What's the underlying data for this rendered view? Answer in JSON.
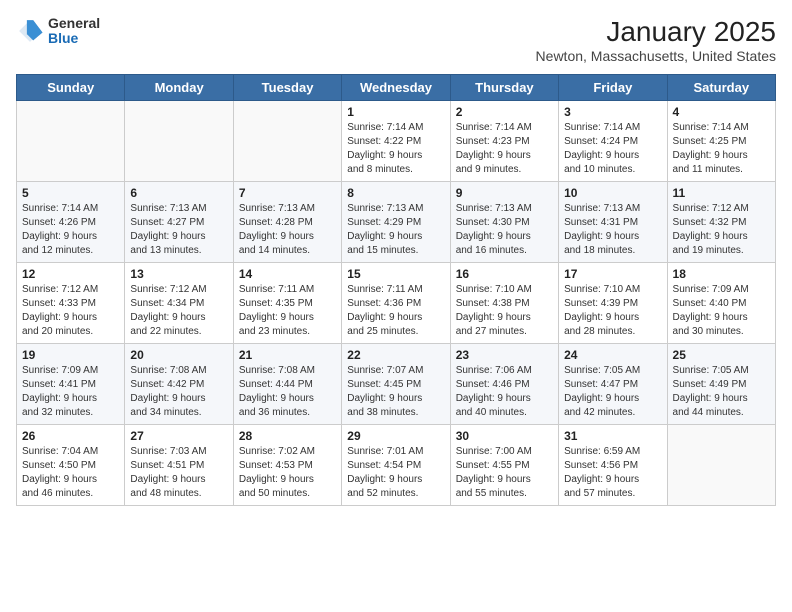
{
  "header": {
    "logo": {
      "general": "General",
      "blue": "Blue"
    },
    "title": "January 2025",
    "location": "Newton, Massachusetts, United States"
  },
  "weekdays": [
    "Sunday",
    "Monday",
    "Tuesday",
    "Wednesday",
    "Thursday",
    "Friday",
    "Saturday"
  ],
  "weeks": [
    [
      {
        "day": "",
        "info": ""
      },
      {
        "day": "",
        "info": ""
      },
      {
        "day": "",
        "info": ""
      },
      {
        "day": "1",
        "info": "Sunrise: 7:14 AM\nSunset: 4:22 PM\nDaylight: 9 hours\nand 8 minutes."
      },
      {
        "day": "2",
        "info": "Sunrise: 7:14 AM\nSunset: 4:23 PM\nDaylight: 9 hours\nand 9 minutes."
      },
      {
        "day": "3",
        "info": "Sunrise: 7:14 AM\nSunset: 4:24 PM\nDaylight: 9 hours\nand 10 minutes."
      },
      {
        "day": "4",
        "info": "Sunrise: 7:14 AM\nSunset: 4:25 PM\nDaylight: 9 hours\nand 11 minutes."
      }
    ],
    [
      {
        "day": "5",
        "info": "Sunrise: 7:14 AM\nSunset: 4:26 PM\nDaylight: 9 hours\nand 12 minutes."
      },
      {
        "day": "6",
        "info": "Sunrise: 7:13 AM\nSunset: 4:27 PM\nDaylight: 9 hours\nand 13 minutes."
      },
      {
        "day": "7",
        "info": "Sunrise: 7:13 AM\nSunset: 4:28 PM\nDaylight: 9 hours\nand 14 minutes."
      },
      {
        "day": "8",
        "info": "Sunrise: 7:13 AM\nSunset: 4:29 PM\nDaylight: 9 hours\nand 15 minutes."
      },
      {
        "day": "9",
        "info": "Sunrise: 7:13 AM\nSunset: 4:30 PM\nDaylight: 9 hours\nand 16 minutes."
      },
      {
        "day": "10",
        "info": "Sunrise: 7:13 AM\nSunset: 4:31 PM\nDaylight: 9 hours\nand 18 minutes."
      },
      {
        "day": "11",
        "info": "Sunrise: 7:12 AM\nSunset: 4:32 PM\nDaylight: 9 hours\nand 19 minutes."
      }
    ],
    [
      {
        "day": "12",
        "info": "Sunrise: 7:12 AM\nSunset: 4:33 PM\nDaylight: 9 hours\nand 20 minutes."
      },
      {
        "day": "13",
        "info": "Sunrise: 7:12 AM\nSunset: 4:34 PM\nDaylight: 9 hours\nand 22 minutes."
      },
      {
        "day": "14",
        "info": "Sunrise: 7:11 AM\nSunset: 4:35 PM\nDaylight: 9 hours\nand 23 minutes."
      },
      {
        "day": "15",
        "info": "Sunrise: 7:11 AM\nSunset: 4:36 PM\nDaylight: 9 hours\nand 25 minutes."
      },
      {
        "day": "16",
        "info": "Sunrise: 7:10 AM\nSunset: 4:38 PM\nDaylight: 9 hours\nand 27 minutes."
      },
      {
        "day": "17",
        "info": "Sunrise: 7:10 AM\nSunset: 4:39 PM\nDaylight: 9 hours\nand 28 minutes."
      },
      {
        "day": "18",
        "info": "Sunrise: 7:09 AM\nSunset: 4:40 PM\nDaylight: 9 hours\nand 30 minutes."
      }
    ],
    [
      {
        "day": "19",
        "info": "Sunrise: 7:09 AM\nSunset: 4:41 PM\nDaylight: 9 hours\nand 32 minutes."
      },
      {
        "day": "20",
        "info": "Sunrise: 7:08 AM\nSunset: 4:42 PM\nDaylight: 9 hours\nand 34 minutes."
      },
      {
        "day": "21",
        "info": "Sunrise: 7:08 AM\nSunset: 4:44 PM\nDaylight: 9 hours\nand 36 minutes."
      },
      {
        "day": "22",
        "info": "Sunrise: 7:07 AM\nSunset: 4:45 PM\nDaylight: 9 hours\nand 38 minutes."
      },
      {
        "day": "23",
        "info": "Sunrise: 7:06 AM\nSunset: 4:46 PM\nDaylight: 9 hours\nand 40 minutes."
      },
      {
        "day": "24",
        "info": "Sunrise: 7:05 AM\nSunset: 4:47 PM\nDaylight: 9 hours\nand 42 minutes."
      },
      {
        "day": "25",
        "info": "Sunrise: 7:05 AM\nSunset: 4:49 PM\nDaylight: 9 hours\nand 44 minutes."
      }
    ],
    [
      {
        "day": "26",
        "info": "Sunrise: 7:04 AM\nSunset: 4:50 PM\nDaylight: 9 hours\nand 46 minutes."
      },
      {
        "day": "27",
        "info": "Sunrise: 7:03 AM\nSunset: 4:51 PM\nDaylight: 9 hours\nand 48 minutes."
      },
      {
        "day": "28",
        "info": "Sunrise: 7:02 AM\nSunset: 4:53 PM\nDaylight: 9 hours\nand 50 minutes."
      },
      {
        "day": "29",
        "info": "Sunrise: 7:01 AM\nSunset: 4:54 PM\nDaylight: 9 hours\nand 52 minutes."
      },
      {
        "day": "30",
        "info": "Sunrise: 7:00 AM\nSunset: 4:55 PM\nDaylight: 9 hours\nand 55 minutes."
      },
      {
        "day": "31",
        "info": "Sunrise: 6:59 AM\nSunset: 4:56 PM\nDaylight: 9 hours\nand 57 minutes."
      },
      {
        "day": "",
        "info": ""
      }
    ]
  ]
}
